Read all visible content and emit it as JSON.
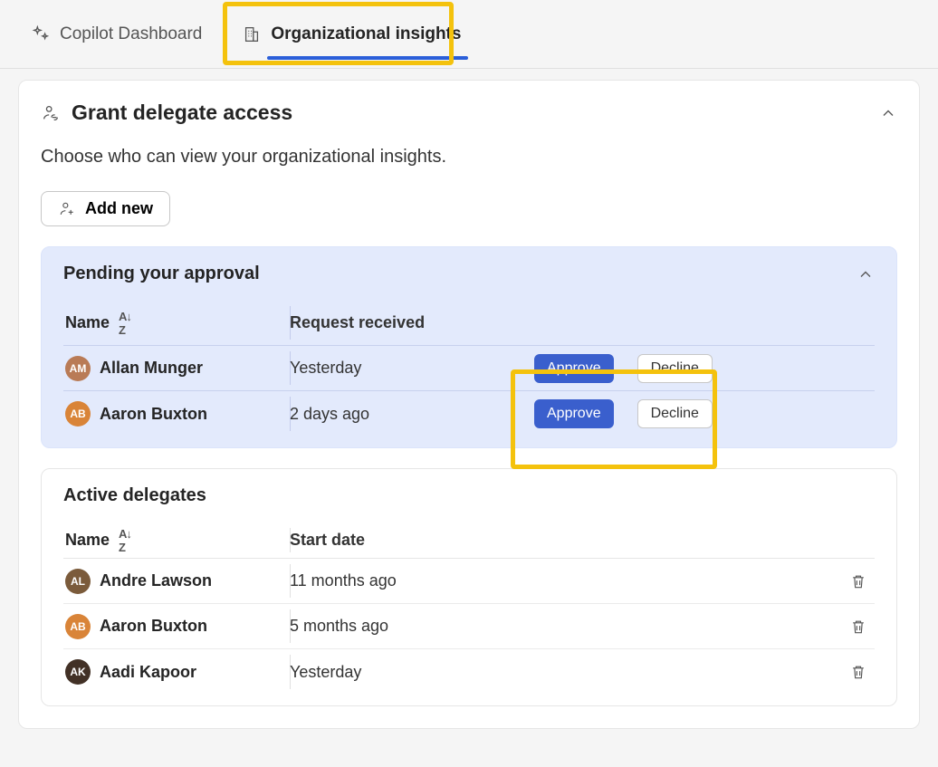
{
  "tabs": {
    "copilot_label": "Copilot Dashboard",
    "org_label": "Organizational insights"
  },
  "card": {
    "title": "Grant delegate access",
    "subtitle": "Choose who can view your organizational insights.",
    "add_new_label": "Add new"
  },
  "pending": {
    "title": "Pending your approval",
    "columns": {
      "name": "Name",
      "received": "Request received"
    },
    "approve_label": "Approve",
    "decline_label": "Decline",
    "rows": [
      {
        "name": "Allan Munger",
        "avatar_color": "#b97b56",
        "received": "Yesterday"
      },
      {
        "name": "Aaron Buxton",
        "avatar_color": "#d98438",
        "received": "2 days ago"
      }
    ]
  },
  "active": {
    "title": "Active delegates",
    "columns": {
      "name": "Name",
      "start": "Start date"
    },
    "rows": [
      {
        "name": "Andre Lawson",
        "avatar_color": "#7b5b3b",
        "start": "11 months ago"
      },
      {
        "name": "Aaron Buxton",
        "avatar_color": "#d98438",
        "start": "5 months ago"
      },
      {
        "name": "Aadi Kapoor",
        "avatar_color": "#423126",
        "start": "Yesterday"
      }
    ]
  }
}
